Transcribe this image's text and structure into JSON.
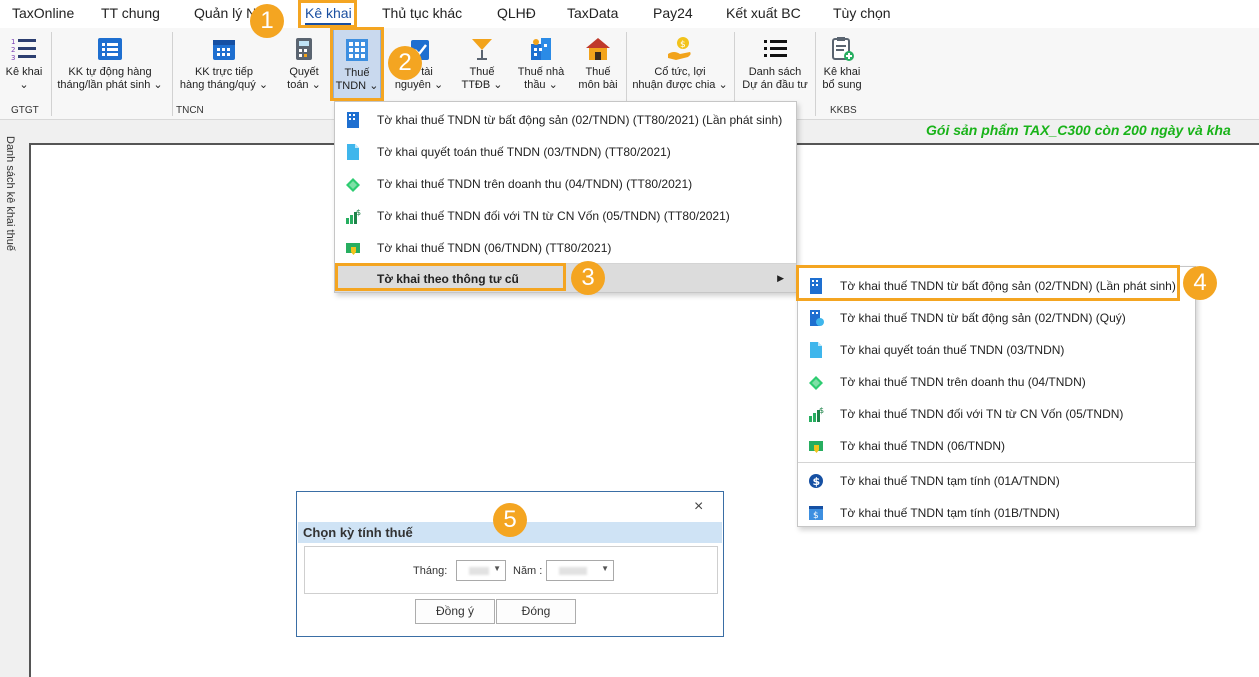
{
  "menu": {
    "items": [
      "TaxOnline",
      "TT chung",
      "Quản lý NV",
      "Kê khai",
      "Thủ tục khác",
      "QLHĐ",
      "TaxData",
      "Pay24",
      "Kết xuất BC",
      "Tùy chọn"
    ],
    "active": "Kê khai"
  },
  "ribbon": {
    "ke_khai": "Kê khai",
    "kk_tu_dong_1": "KK tự động hàng",
    "kk_tu_dong_2": "tháng/lần phát sinh",
    "kk_truc_tiep_1": "KK trực tiếp",
    "kk_truc_tiep_2": "hàng tháng/quý",
    "quyet_toan_1": "Quyết",
    "quyet_toan_2": "toán",
    "thue_tndn_1": "Thuế",
    "thue_tndn_2": "TNDN",
    "tai_nguyen_1": "tài",
    "tai_nguyen_2": "nguyên",
    "ttdb_1": "Thuế",
    "ttdb_2": "TTĐB",
    "nha_thau_1": "Thuế nhà",
    "nha_thau_2": "thầu",
    "mon_bai_1": "Thuế",
    "mon_bai_2": "môn bài",
    "co_tuc_1": "Cổ tức, lợi",
    "co_tuc_2": "nhuận được chia",
    "du_an_1": "Danh sách",
    "du_an_2": "Dự án đầu tư",
    "bo_sung_1": "Kê khai",
    "bo_sung_2": "bổ sung",
    "groups": {
      "gtgt": "GTGT",
      "tncn": "TNCN",
      "kkbs": "KKBS"
    }
  },
  "promo": "Gói sản phẩm TAX_C300 còn 200 ngày và kha",
  "side_tab": "Danh sách kê khai thuế",
  "dropdown_main": {
    "items": [
      "Tờ khai thuế TNDN từ bất động sản (02/TNDN) (TT80/2021) (Lần phát sinh)",
      "Tờ khai quyết toán thuế TNDN (03/TNDN) (TT80/2021)",
      "Tờ khai thuế TNDN trên doanh thu (04/TNDN) (TT80/2021)",
      "Tờ khai thuế TNDN đối với TN từ CN Vốn (05/TNDN) (TT80/2021)",
      "Tờ khai thuế TNDN (06/TNDN) (TT80/2021)"
    ],
    "submenu_label": "Tờ khai theo thông tư cũ"
  },
  "dropdown_sub": {
    "items": [
      "Tờ khai thuế TNDN từ bất động sản (02/TNDN) (Lần phát sinh)",
      "Tờ khai thuế TNDN từ bất động sản (02/TNDN) (Quý)",
      "Tờ khai quyết toán thuế TNDN (03/TNDN)",
      "Tờ khai thuế TNDN trên doanh thu (04/TNDN)",
      "Tờ khai thuế TNDN đối với TN từ CN Vốn (05/TNDN)",
      "Tờ khai thuế TNDN (06/TNDN)",
      "Tờ khai thuế TNDN tạm tính (01A/TNDN)",
      "Tờ khai thuế TNDN tạm tính (01B/TNDN)"
    ]
  },
  "dialog": {
    "close": "×",
    "title": "Chọn kỳ tính thuế",
    "month_label": "Tháng:",
    "year_label": "Năm :",
    "ok": "Đồng ý",
    "close_btn": "Đóng"
  },
  "steps": [
    "1",
    "2",
    "3",
    "4",
    "5"
  ],
  "colors": {
    "highlight": "#f4a521",
    "promo": "#19b319",
    "dialog_header": "#cfe3f5",
    "menu_active": "#1a4fa0"
  }
}
